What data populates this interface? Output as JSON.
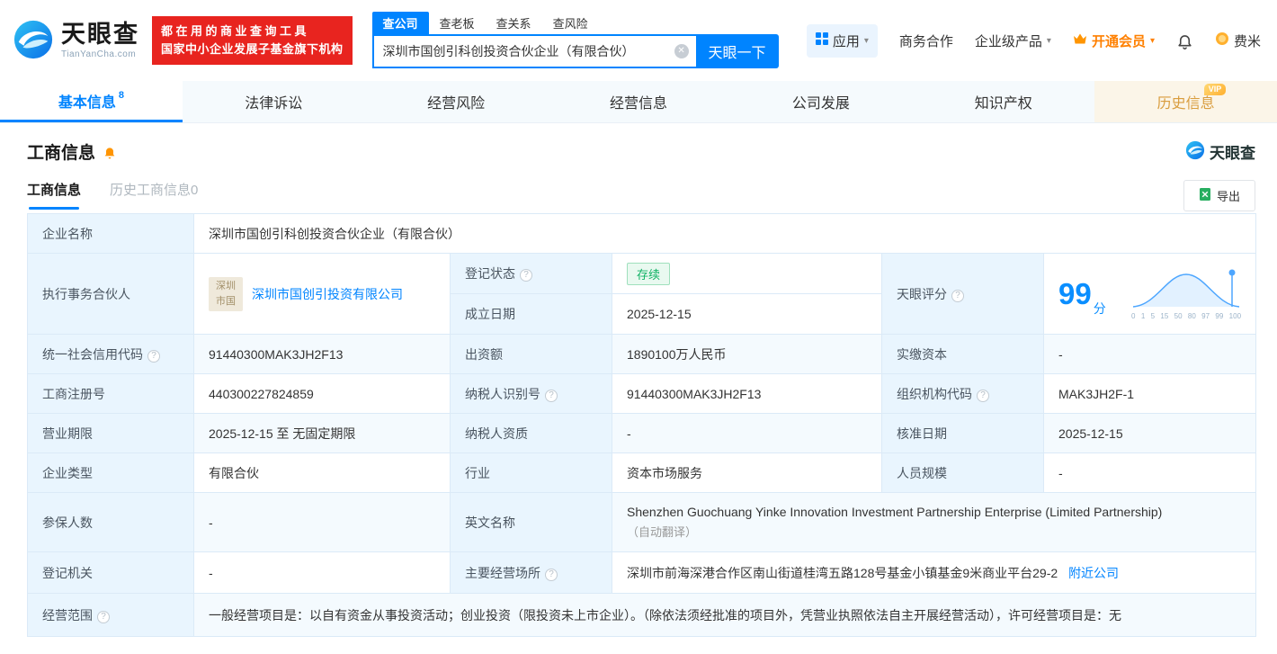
{
  "colors": {
    "primary": "#0084ff",
    "brand_red": "#e8241f",
    "vip_orange": "#ff8000",
    "status_green": "#0fb264"
  },
  "icons": {
    "help": "?",
    "clear": "✕",
    "caret": "▾"
  },
  "brand": {
    "name": "天眼查",
    "domain": "TianYanCha.com",
    "slogan1": "都在用的商业查询工具",
    "slogan2": "国家中小企业发展子基金旗下机构"
  },
  "search": {
    "tabs": [
      "查公司",
      "查老板",
      "查关系",
      "查风险"
    ],
    "value": "深圳市国创引科创投资合伙企业（有限合伙）",
    "button": "天眼一下"
  },
  "menu": {
    "apps": "应用",
    "biz": "商务合作",
    "enterprise": "企业级产品",
    "vip": "开通会员",
    "user": "费米"
  },
  "nav": {
    "tabs": [
      {
        "label": "基本信息",
        "badge": "8"
      },
      {
        "label": "法律诉讼"
      },
      {
        "label": "经营风险"
      },
      {
        "label": "经营信息"
      },
      {
        "label": "公司发展"
      },
      {
        "label": "知识产权"
      },
      {
        "label": "历史信息",
        "vip": "VIP"
      }
    ]
  },
  "section": {
    "title": "工商信息",
    "subtabs": [
      "工商信息",
      "历史工商信息0"
    ],
    "export": "导出"
  },
  "info": {
    "company_name_label": "企业名称",
    "company_name": "深圳市国创引科创投资合伙企业（有限合伙）",
    "partner_label": "执行事务合伙人",
    "partner_logo_text": "深圳市国",
    "partner_name": "深圳市国创引投资有限公司",
    "reg_status_label": "登记状态",
    "reg_status": "存续",
    "est_date_label": "成立日期",
    "est_date": "2025-12-15",
    "score_label": "天眼评分",
    "score_value": "99",
    "score_unit": "分",
    "score_axis": [
      "0",
      "1",
      "5",
      "15",
      "50",
      "80",
      "97",
      "99",
      "100"
    ],
    "uscc_label": "统一社会信用代码",
    "uscc": "91440300MAK3JH2F13",
    "capital_label": "出资额",
    "capital": "1890100万人民币",
    "paid_capital_label": "实缴资本",
    "paid_capital": "-",
    "reg_no_label": "工商注册号",
    "reg_no": "440300227824859",
    "taxpayer_id_label": "纳税人识别号",
    "taxpayer_id": "91440300MAK3JH2F13",
    "org_code_label": "组织机构代码",
    "org_code": "MAK3JH2F-1",
    "term_label": "营业期限",
    "term": "2025-12-15 至 无固定期限",
    "taxpayer_quali_label": "纳税人资质",
    "taxpayer_quali": "-",
    "approval_date_label": "核准日期",
    "approval_date": "2025-12-15",
    "type_label": "企业类型",
    "type": "有限合伙",
    "industry_label": "行业",
    "industry": "资本市场服务",
    "staff_label": "人员规模",
    "staff": "-",
    "insured_label": "参保人数",
    "insured": "-",
    "en_name_label": "英文名称",
    "en_name": "Shenzhen Guochuang Yinke Innovation Investment Partnership Enterprise (Limited Partnership)",
    "en_name_note": "（自动翻译）",
    "authority_label": "登记机关",
    "authority": "-",
    "address_label": "主要经营场所",
    "address": "深圳市前海深港合作区南山街道桂湾五路128号基金小镇基金9米商业平台29-2",
    "nearby_link": "附近公司",
    "scope_label": "经营范围",
    "scope": "一般经营项目是：以自有资金从事投资活动；创业投资（限投资未上市企业）。（除依法须经批准的项目外，凭营业执照依法自主开展经营活动），许可经营项目是：无"
  }
}
